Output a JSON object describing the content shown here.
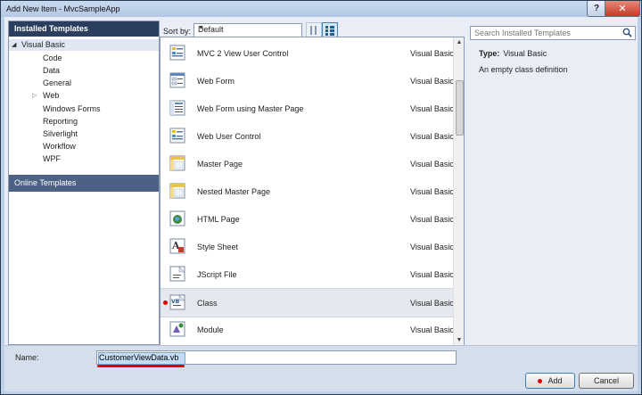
{
  "window": {
    "title": "Add New Item - MvcSampleApp",
    "help_symbol": "?",
    "close_symbol": "✕"
  },
  "left_nav": {
    "header": "Installed Templates",
    "root": "Visual Basic",
    "items": [
      "Code",
      "Data",
      "General",
      "Web",
      "Windows Forms",
      "Reporting",
      "Silverlight",
      "Workflow",
      "WPF"
    ],
    "online": "Online Templates"
  },
  "sort": {
    "label": "Sort by:",
    "value": "Default"
  },
  "search": {
    "placeholder": "Search Installed Templates"
  },
  "templates": [
    {
      "name": "MVC 2 View User Control",
      "lang": "Visual Basic",
      "icon": "user-control-icon"
    },
    {
      "name": "Web Form",
      "lang": "Visual Basic",
      "icon": "web-form-icon"
    },
    {
      "name": "Web Form using Master Page",
      "lang": "Visual Basic",
      "icon": "web-form-master-icon"
    },
    {
      "name": "Web User Control",
      "lang": "Visual Basic",
      "icon": "user-control-icon"
    },
    {
      "name": "Master Page",
      "lang": "Visual Basic",
      "icon": "master-page-icon"
    },
    {
      "name": "Nested Master Page",
      "lang": "Visual Basic",
      "icon": "master-page-icon"
    },
    {
      "name": "HTML Page",
      "lang": "Visual Basic",
      "icon": "html-page-icon"
    },
    {
      "name": "Style Sheet",
      "lang": "Visual Basic",
      "icon": "style-sheet-icon"
    },
    {
      "name": "JScript File",
      "lang": "Visual Basic",
      "icon": "jscript-file-icon"
    },
    {
      "name": "Class",
      "lang": "Visual Basic",
      "icon": "vb-class-icon",
      "selected": true
    },
    {
      "name": "Module",
      "lang": "Visual Basic",
      "icon": "module-icon"
    }
  ],
  "detail": {
    "type_label": "Type:",
    "type_value": "Visual Basic",
    "description": "An empty class definition"
  },
  "name_field": {
    "label": "Name:",
    "value": "CustomerViewData.vb"
  },
  "buttons": {
    "add": "Add",
    "cancel": "Cancel"
  },
  "colors": {
    "annotation_red": "#e00000",
    "nav_header": "#2b3e5e",
    "selection": "#e5e9ef"
  }
}
